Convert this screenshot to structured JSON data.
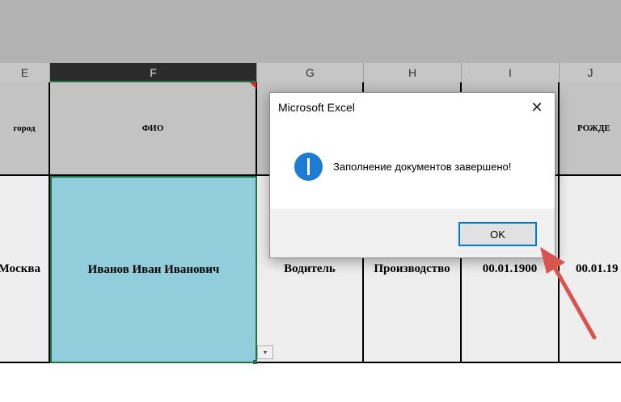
{
  "columns": [
    {
      "letter": "E"
    },
    {
      "letter": "F"
    },
    {
      "letter": "G"
    },
    {
      "letter": "H"
    },
    {
      "letter": "I"
    },
    {
      "letter": "J"
    }
  ],
  "header_row": {
    "E": "город",
    "F": "ФИО",
    "J": "РОЖДЕ"
  },
  "data_row": {
    "E": "Москва",
    "F": "Иванов Иван Иванович",
    "G": "Водитель",
    "H": "Производство",
    "I": "00.01.1900",
    "J": "00.01.19"
  },
  "dialog": {
    "title": "Microsoft Excel",
    "close_glyph": "✕",
    "message": "Заполнение документов завершено!",
    "ok_label": "OK"
  },
  "autofill_glyph": "▾",
  "colors": {
    "selected_cell": "#92cddc",
    "excel_green": "#217346",
    "info_blue": "#1e7bd4",
    "ok_border": "#0078d7",
    "arrow_red": "#d9534f"
  }
}
